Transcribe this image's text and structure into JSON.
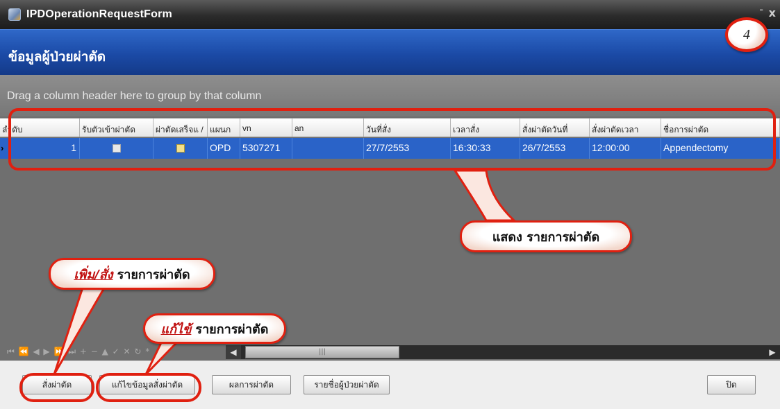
{
  "window": {
    "title": "IPDOperationRequestForm",
    "minimize_glyph": "-",
    "close_glyph": "x"
  },
  "header": {
    "title": "ข้อมูลผู้ป่วยผ่าตัด"
  },
  "step_badge": "4",
  "group_panel": {
    "text": "Drag a column header here to group by that column"
  },
  "grid": {
    "columns": [
      "ลำดับ",
      "รับตัวเข้าผ่าตัด",
      "ผ่าตัดเสร็จแ /",
      "แผนก",
      "vn",
      "an",
      "วันที่สั่ง",
      "เวลาสั่ง",
      "สั่งผ่าตัดวันที่",
      "สั่งผ่าตัดเวลา",
      "ชื่อการผ่าตัด"
    ],
    "rows": [
      {
        "indicator": "›",
        "order": "1",
        "received": false,
        "finished": true,
        "dept": "OPD",
        "vn": "5307271",
        "an": "",
        "order_date": "27/7/2553",
        "order_time": "16:30:33",
        "op_date": "26/7/2553",
        "op_time": "12:00:00",
        "op_name": "Appendectomy"
      }
    ]
  },
  "navigator": {
    "glyphs": "⏮ ⏪ ◀ ▶ ⏩ ⏭ + − ▲ ✓ ✕ ↻ *"
  },
  "scrollbar": {
    "left_arrow": "◀",
    "right_arrow": "▶",
    "thumb_grip": "|||"
  },
  "buttons": {
    "order_op": "สั่งผ่าตัด",
    "edit_order": "แก้ไขข้อมูลสั่งผ่าตัด",
    "op_result": "ผลการผ่าตัด",
    "patient_list": "รายชื่อผู้ป่วยผ่าตัด",
    "close": "ปิด"
  },
  "callouts": {
    "show_list": {
      "text": "แสดง รายการผ่าตัด"
    },
    "add_order": {
      "emphasis": "เพิ่ม/สั่ง",
      "text": "รายการผ่าตัด"
    },
    "edit": {
      "emphasis": "แก้ไข้",
      "text": "รายการผ่าตัด"
    }
  },
  "colors": {
    "title_bar": "#2b2b2b",
    "header_band": "#1b4aa6",
    "selected_row": "#2a63c8",
    "callout_red": "#e02010"
  }
}
